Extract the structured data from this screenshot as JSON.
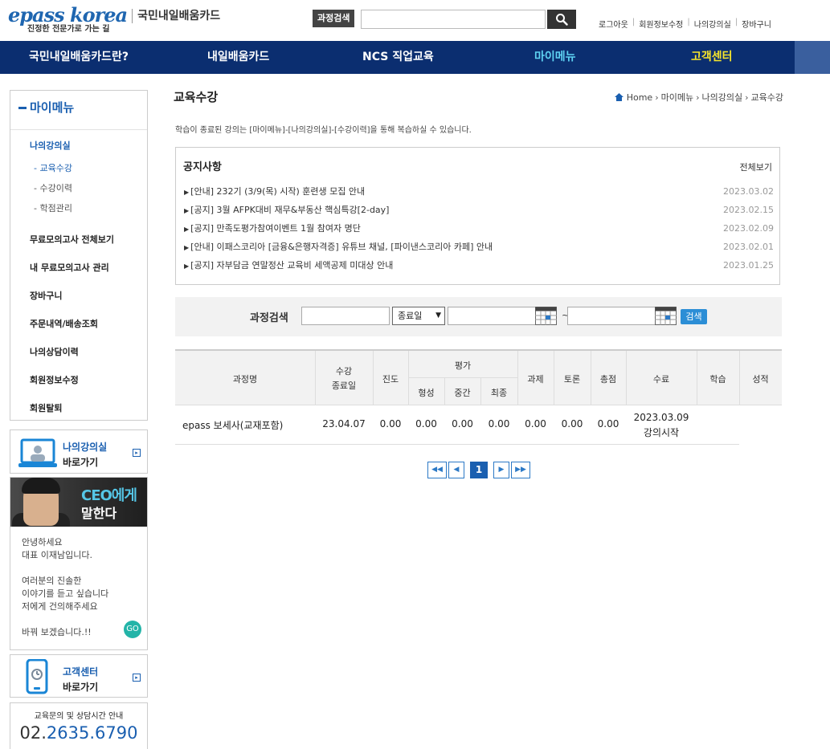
{
  "header": {
    "logo_main": "epass korea",
    "logo_card": "국민내일배움카드",
    "logo_tagline": "진정한 전문가로 가는 길",
    "search_label": "과정검색",
    "search_placeholder": "",
    "util_links": [
      "로그아웃",
      "회원정보수정",
      "나의강의실",
      "장바구니"
    ]
  },
  "gnb": {
    "items": [
      "국민내일배움카드란?",
      "내일배움카드",
      "NCS 직업교육",
      "마이메뉴",
      "고객센터"
    ],
    "colors": {
      "bg": "#0b2e70",
      "active": "#5ed2f2",
      "highlight": "#f7e52c"
    }
  },
  "lnb": {
    "title": "마이메뉴",
    "section": "나의강의실",
    "subs": [
      "- 교육수강",
      "- 수강이력",
      "- 학점관리"
    ],
    "items": [
      "무료모의고사 전체보기",
      "내 무료모의고사 관리",
      "장바구니",
      "주문내역/배송조회",
      "나의상담이력",
      "회원정보수정",
      "회원탈퇴"
    ]
  },
  "banners": {
    "classroom": {
      "t1": "나의강의실",
      "t2": "바로가기"
    },
    "support": {
      "t1": "고객센터",
      "t2": "바로가기"
    }
  },
  "ceo": {
    "title_accent": "CEO에게",
    "title_main": "말한다",
    "lines": [
      "안녕하세요",
      "대표 이재남입니다.",
      "",
      "여러분의 진솔한",
      "이야기를 듣고 싶습니다",
      "저에게 건의해주세요",
      "",
      "바꿔 보겠습니다.!!"
    ],
    "go": "GO"
  },
  "contact": {
    "label": "교육문의 및 상담시간 안내",
    "phone_prefix": "02.",
    "phone_rest": "2635.6790"
  },
  "page": {
    "title": "교육수강",
    "breadcrumb": [
      "Home",
      "마이메뉴",
      "나의강의실",
      "교육수강"
    ],
    "intro": "학습이 종료된 강의는 [마이메뉴]-[나의강의실]-[수강이력]을 통해 복습하실 수 있습니다."
  },
  "notice": {
    "title": "공지사항",
    "more": "전체보기",
    "rows": [
      {
        "text": "[안내] 232기 (3/9(목) 시작) 훈련생 모집 안내",
        "date": "2023.03.02"
      },
      {
        "text": "[공지] 3월 AFPK대비 재무&부동산 핵심특강[2-day]",
        "date": "2023.02.15"
      },
      {
        "text": "[공지] 만족도평가참여이벤트 1월 참여자 명단",
        "date": "2023.02.09"
      },
      {
        "text": "[안내] 이패스코리아 [금융&은행자격증] 유튜브 채널, [파이낸스코리아 카페] 안내",
        "date": "2023.02.01"
      },
      {
        "text": "[공지] 자부담금 연말정산 교육비 세액공제 미대상 안내",
        "date": "2023.01.25"
      }
    ]
  },
  "course_search": {
    "label": "과정검색",
    "select_value": "종료일",
    "tilde": "~",
    "button": "검색"
  },
  "table": {
    "headers": {
      "name": "과정명",
      "end_1": "수강",
      "end_2": "종료일",
      "progress": "진도",
      "eval": "평가",
      "eval_sub": [
        "형성",
        "중간",
        "최종"
      ],
      "task": "과제",
      "discuss": "토론",
      "total": "총점",
      "complete": "수료",
      "study": "학습",
      "grade": "성적"
    },
    "rows": [
      {
        "name": "epass 보세사(교재포함)",
        "end": "23.04.07",
        "progress": "0.00",
        "formative": "0.00",
        "midterm": "0.00",
        "final": "0.00",
        "task": "0.00",
        "discuss": "0.00",
        "total": "0.00",
        "complete_1": "2023.03.09",
        "complete_2": "강의시작"
      }
    ]
  },
  "pager": {
    "current": "1",
    "first": "◀◀",
    "prev": "◀",
    "next": "▶",
    "last": "▶▶"
  }
}
